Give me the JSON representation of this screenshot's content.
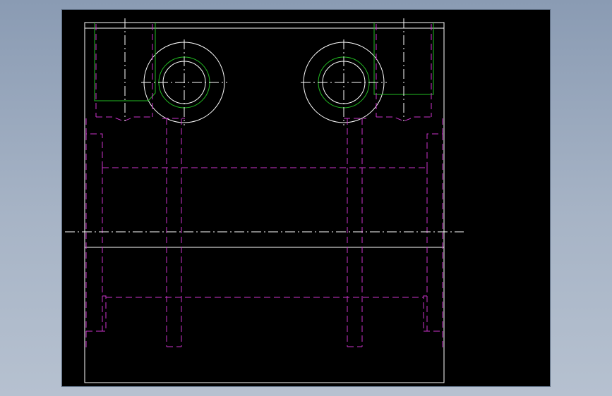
{
  "colors": {
    "outline": "#ffffff",
    "hidden": "#cc33cc",
    "visible_detail": "#22bb22",
    "center": "#ffffff",
    "background": "#000000"
  }
}
